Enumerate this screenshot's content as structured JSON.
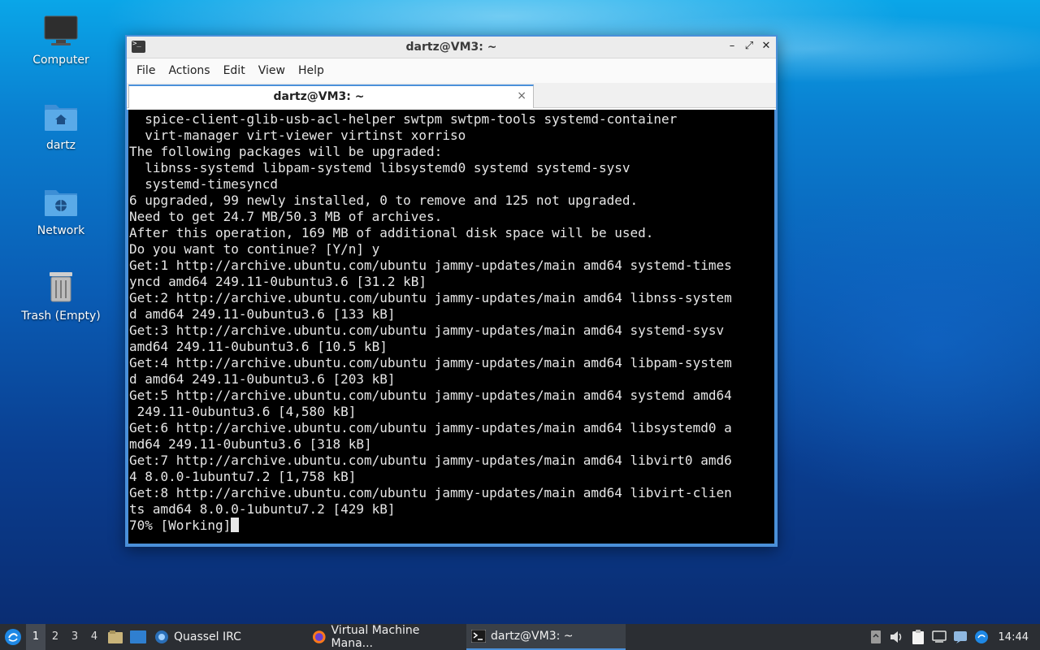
{
  "desktop": {
    "icons": [
      {
        "label": "Computer",
        "icon": "computer-icon"
      },
      {
        "label": "dartz",
        "icon": "home-folder-icon"
      },
      {
        "label": "Network",
        "icon": "network-folder-icon"
      },
      {
        "label": "Trash (Empty)",
        "icon": "trash-icon"
      }
    ]
  },
  "window": {
    "title": "dartz@VM3: ~",
    "menu": [
      "File",
      "Actions",
      "Edit",
      "View",
      "Help"
    ],
    "tab": {
      "label": "dartz@VM3: ~",
      "close": "×"
    },
    "controls": {
      "minimize": "–",
      "maximize": "⤢",
      "close": "✕"
    }
  },
  "terminal": {
    "lines": [
      "  spice-client-glib-usb-acl-helper swtpm swtpm-tools systemd-container",
      "  virt-manager virt-viewer virtinst xorriso",
      "The following packages will be upgraded:",
      "  libnss-systemd libpam-systemd libsystemd0 systemd systemd-sysv",
      "  systemd-timesyncd",
      "6 upgraded, 99 newly installed, 0 to remove and 125 not upgraded.",
      "Need to get 24.7 MB/50.3 MB of archives.",
      "After this operation, 169 MB of additional disk space will be used.",
      "Do you want to continue? [Y/n] y",
      "Get:1 http://archive.ubuntu.com/ubuntu jammy-updates/main amd64 systemd-times",
      "yncd amd64 249.11-0ubuntu3.6 [31.2 kB]",
      "Get:2 http://archive.ubuntu.com/ubuntu jammy-updates/main amd64 libnss-system",
      "d amd64 249.11-0ubuntu3.6 [133 kB]",
      "Get:3 http://archive.ubuntu.com/ubuntu jammy-updates/main amd64 systemd-sysv",
      "amd64 249.11-0ubuntu3.6 [10.5 kB]",
      "Get:4 http://archive.ubuntu.com/ubuntu jammy-updates/main amd64 libpam-system",
      "d amd64 249.11-0ubuntu3.6 [203 kB]",
      "Get:5 http://archive.ubuntu.com/ubuntu jammy-updates/main amd64 systemd amd64",
      " 249.11-0ubuntu3.6 [4,580 kB]",
      "Get:6 http://archive.ubuntu.com/ubuntu jammy-updates/main amd64 libsystemd0 a",
      "md64 249.11-0ubuntu3.6 [318 kB]",
      "Get:7 http://archive.ubuntu.com/ubuntu jammy-updates/main amd64 libvirt0 amd6",
      "4 8.0.0-1ubuntu7.2 [1,758 kB]",
      "Get:8 http://archive.ubuntu.com/ubuntu jammy-updates/main amd64 libvirt-clien",
      "ts amd64 8.0.0-1ubuntu7.2 [429 kB]"
    ],
    "prompt_line": "70% [Working]"
  },
  "taskbar": {
    "workspaces": [
      "1",
      "2",
      "3",
      "4"
    ],
    "active_workspace": "1",
    "tasks": [
      {
        "label": "Quassel IRC",
        "icon": "quassel-icon"
      },
      {
        "label": "Virtual Machine Mana...",
        "icon": "firefox-icon"
      },
      {
        "label": "dartz@VM3: ~",
        "icon": "terminal-icon"
      }
    ],
    "clock": "14:44"
  },
  "colors": {
    "accent": "#4a90d9",
    "terminal_bg": "#000000",
    "taskbar_bg": "#2b2e33"
  }
}
